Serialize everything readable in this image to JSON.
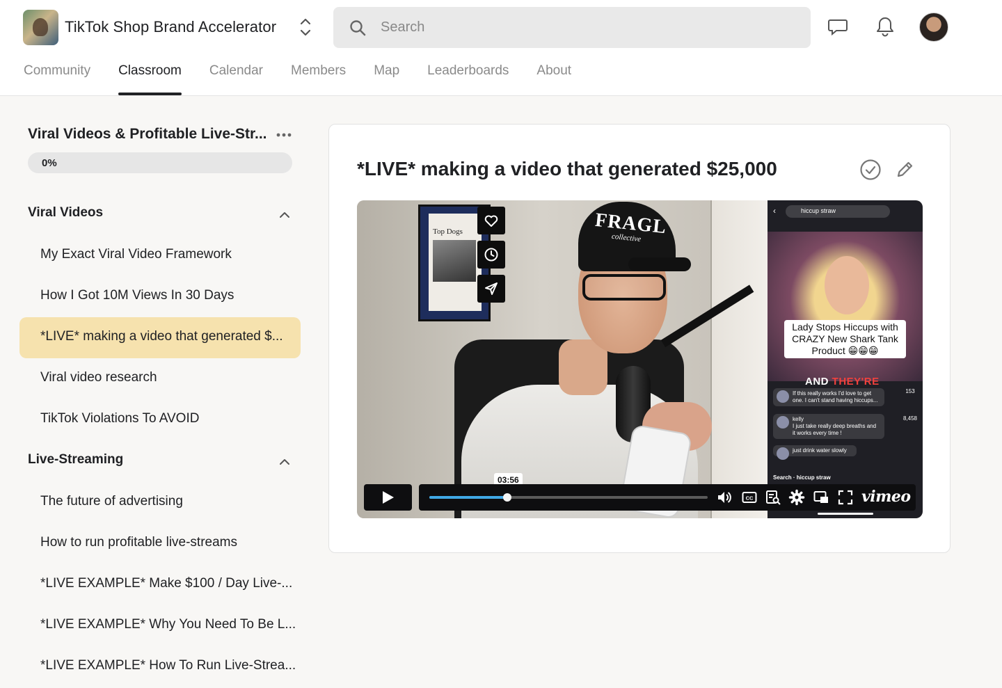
{
  "header": {
    "group_name": "TikTok Shop Brand Accelerator",
    "search_placeholder": "Search"
  },
  "tabs": [
    {
      "label": "Community",
      "active": false
    },
    {
      "label": "Classroom",
      "active": true
    },
    {
      "label": "Calendar",
      "active": false
    },
    {
      "label": "Members",
      "active": false
    },
    {
      "label": "Map",
      "active": false
    },
    {
      "label": "Leaderboards",
      "active": false
    },
    {
      "label": "About",
      "active": false
    }
  ],
  "sidebar": {
    "course_title": "Viral Videos & Profitable Live-Str...",
    "progress_label": "0%",
    "progress_value": 0,
    "sections": [
      {
        "title": "Viral Videos",
        "expanded": true,
        "lessons": [
          {
            "label": "My Exact Viral Video Framework",
            "active": false
          },
          {
            "label": "How I Got 10M Views In 30 Days",
            "active": false
          },
          {
            "label": "*LIVE* making a video that generated $...",
            "active": true
          },
          {
            "label": "Viral video research",
            "active": false
          },
          {
            "label": "TikTok Violations To AVOID",
            "active": false
          }
        ]
      },
      {
        "title": "Live-Streaming",
        "expanded": true,
        "lessons": [
          {
            "label": "The future of advertising",
            "active": false
          },
          {
            "label": "How to run profitable live-streams",
            "active": false
          },
          {
            "label": "*LIVE EXAMPLE* Make $100 / Day Live-...",
            "active": false
          },
          {
            "label": "*LIVE EXAMPLE* Why You Need To Be L...",
            "active": false
          },
          {
            "label": "*LIVE EXAMPLE* How To Run Live-Strea...",
            "active": false
          }
        ]
      }
    ]
  },
  "lesson": {
    "title": "*LIVE* making a video that generated $25,000"
  },
  "video": {
    "timecode": "03:56",
    "progress": 0.28,
    "player_brand": "vimeo",
    "cap_text": "FRAGL",
    "cap_subtext": "collective",
    "frame_text": "Top Dogs",
    "tiktok": {
      "search_text": "hiccup straw",
      "caption": "Lady Stops Hiccups with CRAZY New Shark Tank Product 😁😁😁",
      "banner_white": "AND ",
      "banner_red": "THEY'RE",
      "comment1": "If this really works I'd love to get one. I can't stand having hiccups...",
      "comment2_user": "kelly",
      "comment2": "I just take really deep breaths and it works every time !",
      "comment3": "just drink water slowly",
      "count_comments": "153",
      "count_saves": "8,458",
      "bottom_search": "Search · hiccup straw"
    }
  },
  "colors": {
    "active_lesson_bg": "#f6e2ae",
    "scrub_fill": "#40a8e6",
    "tiktok_red": "#f2413d"
  }
}
